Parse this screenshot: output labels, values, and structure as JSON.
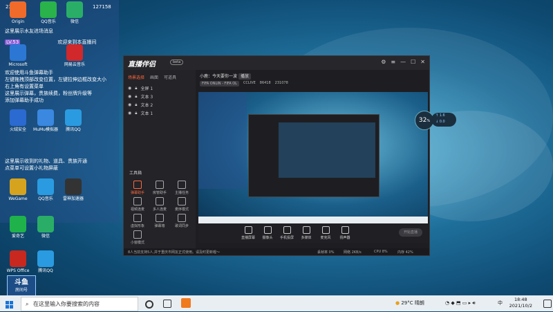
{
  "overlay": {
    "top_id": "231078",
    "top_heart": "127158",
    "messages": [
      "这里展示水友进场消息"
    ],
    "welcome_badge": "LV.53",
    "welcome_text": "欢迎来到本直播间",
    "help_text": "欢迎使用斗鱼弹幕助手\n左键拖拽顶部改变位置，左键拉伸边框改变大小\n右上角有设置菜单\n这里展示弹幕，贵族续费，粉丝牌升级等\n添加弹幕助手成功",
    "gift_text": "这里展示收到的礼物、道具、贵族开通\n点菜单可设置小礼物屏蔽"
  },
  "desktop_icons": [
    {
      "label": "Origin",
      "color": "#f06a2a"
    },
    {
      "label": "QQ音乐",
      "color": "#29b34a"
    },
    {
      "label": "微信",
      "color": "#2aae67"
    },
    {
      "label": "Microsoft",
      "color": "#2c77d4"
    },
    {
      "label": "网易云音乐",
      "color": "#d0282b"
    },
    {
      "label": "火绒安全",
      "color": "#2b6ad0"
    },
    {
      "label": "MuMu模拟器",
      "color": "#3a88e0"
    },
    {
      "label": "腾讯QQ",
      "color": "#2a9be0"
    },
    {
      "label": "WeGame",
      "color": "#d6a31e"
    },
    {
      "label": "QQ音乐",
      "color": "#2a9be0"
    },
    {
      "label": "雷神加速器",
      "color": "#333"
    },
    {
      "label": "爱奇艺",
      "color": "#1fb24a"
    },
    {
      "label": "微信",
      "color": "#2aae67"
    },
    {
      "label": "WPS Office",
      "color": "#c8281e"
    },
    {
      "label": "腾讯QQ",
      "color": "#2a9be0"
    }
  ],
  "app": {
    "title": "直播伴侣",
    "version": "beta",
    "left_tabs": [
      "场景选择",
      "画面",
      "可道具"
    ],
    "scenes": [
      "全屏 1",
      "文本 3",
      "文本 2",
      "文本 1"
    ],
    "tools_title": "工具箱",
    "tools": [
      "弹幕助手",
      "房管助手",
      "主播任务",
      "视频连麦",
      "多人连麦",
      "麦序模式",
      "虚拟形象",
      "弹幕墙",
      "歌词同步",
      "小窗模式"
    ],
    "room_title": "小鹿：今天要你一波",
    "room_badge": "播放",
    "room_tags": [
      "FIFA ONLIN - FIFA OL",
      "CCLIVE",
      "86418",
      "231078"
    ],
    "bottom_tools": [
      "直播屏幕",
      "摄像头",
      "手机投屏",
      "多媒体",
      "麦克风",
      "扬声器"
    ],
    "live_button": "开始直播",
    "status_text": "8人当前支持5人,并于重庆市网友正式使用。请及时更新喔～",
    "stats": [
      "丢帧率 0%",
      "网络 2KB/s",
      "CPU 8%",
      "内存 42%"
    ]
  },
  "speed_widget": {
    "value": "32",
    "unit": "%",
    "up": "1.6",
    "down": "0.0"
  },
  "taskbar": {
    "search_placeholder": "在这里输入你要搜索的内容",
    "weather": "29°C 晴朗",
    "time": "18:48",
    "date": "2021/10/2",
    "lang": "中"
  },
  "watermark": {
    "line1": "斗鱼",
    "line2": "房间号"
  }
}
